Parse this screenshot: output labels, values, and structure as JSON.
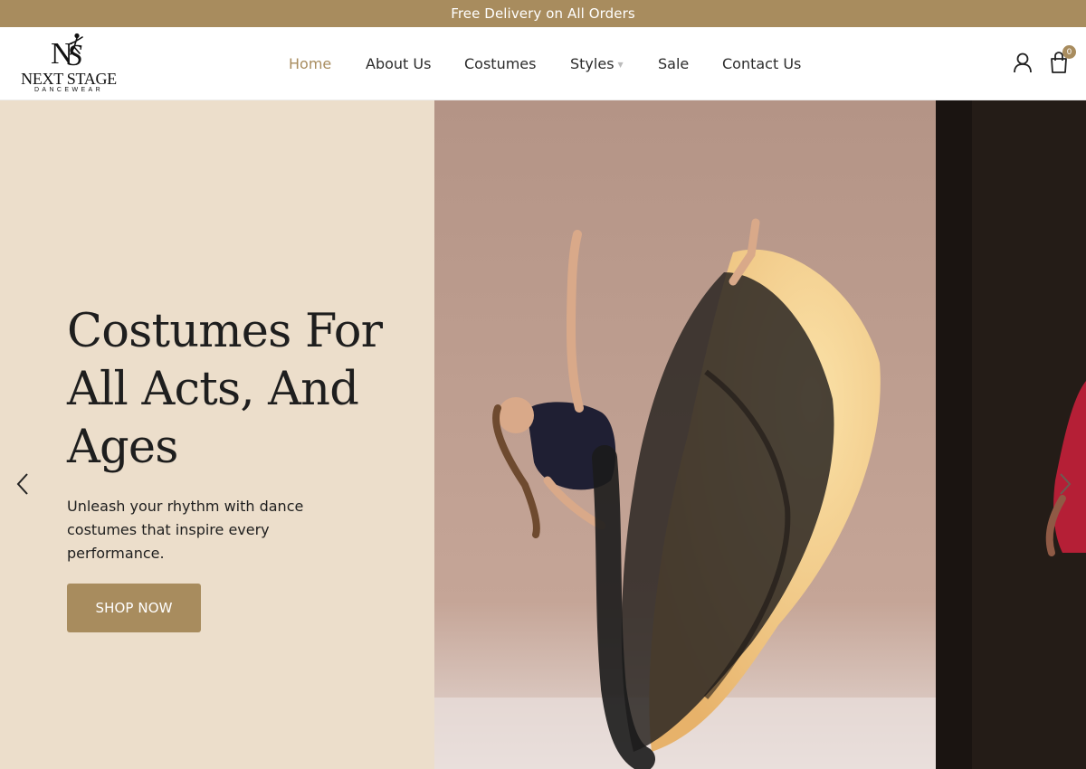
{
  "announcement": "Free Delivery on All Orders",
  "logo": {
    "wordmark": "NEXT STAGE",
    "tagline": "DANCEWEAR"
  },
  "nav": {
    "items": [
      {
        "label": "Home"
      },
      {
        "label": "About Us"
      },
      {
        "label": "Costumes"
      },
      {
        "label": "Styles"
      },
      {
        "label": "Sale"
      },
      {
        "label": "Contact Us"
      }
    ],
    "active": "Home"
  },
  "cart": {
    "count": "0"
  },
  "icons": {
    "account": "user-icon",
    "cart": "shopping-bag-icon",
    "prev": "chevron-left-icon",
    "next": "chevron-right-icon",
    "styles_caret": "chevron-down-icon"
  },
  "hero": {
    "headline_lines": [
      "Costumes For",
      "All Acts, And",
      "Ages"
    ],
    "subtext": "Unleash your rhythm with dance costumes that inspire every performance.",
    "cta": "SHOP NOW"
  },
  "colors": {
    "accent": "#a88c5e",
    "hero_bg": "#ecdecb",
    "text": "#1e1e1e"
  }
}
